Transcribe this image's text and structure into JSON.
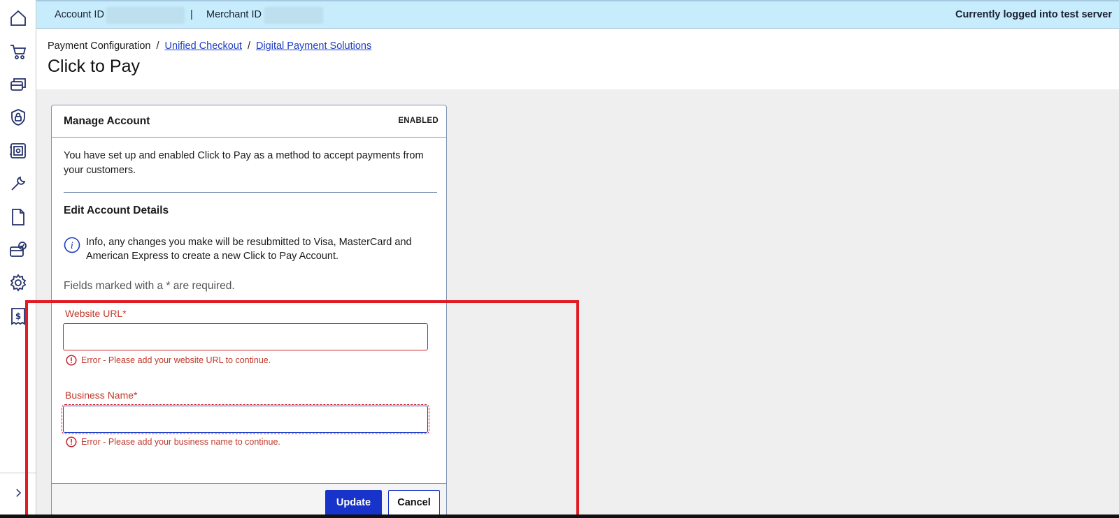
{
  "topbar": {
    "account_label": "Account ID",
    "separator": "|",
    "merchant_label": "Merchant ID",
    "status": "Currently logged into test server"
  },
  "sidebar": {
    "icons": [
      "home-icon",
      "cart-icon",
      "cards-icon",
      "shield-icon",
      "safe-icon",
      "wrench-icon",
      "document-icon",
      "card-check-icon",
      "gear-icon",
      "receipt-dollar-icon"
    ],
    "expand_icon": "chevron-right-icon"
  },
  "breadcrumb": {
    "root": "Payment Configuration",
    "sep": "/",
    "link1": "Unified Checkout",
    "link2": "Digital Payment Solutions"
  },
  "page_title": "Click to Pay",
  "card": {
    "title": "Manage Account",
    "status": "ENABLED",
    "description": "You have set up and enabled Click to Pay as a method to accept payments from your customers.",
    "section_title": "Edit Account Details",
    "info_text": "Info, any changes you make will be resubmitted to Visa, MasterCard and American Express to create a new Click to Pay Account.",
    "required_note": "Fields marked with a * are required.",
    "fields": {
      "website": {
        "label": "Website URL*",
        "value": "",
        "error": "Error - Please add your website URL to continue."
      },
      "business": {
        "label": "Business Name*",
        "value": "",
        "error": "Error - Please add your business name to continue."
      }
    },
    "buttons": {
      "update": "Update",
      "cancel": "Cancel"
    }
  },
  "colors": {
    "accent": "#1733c9",
    "error": "#c8232c",
    "topbar": "#c7ecfb",
    "highlight": "#e11b22"
  }
}
